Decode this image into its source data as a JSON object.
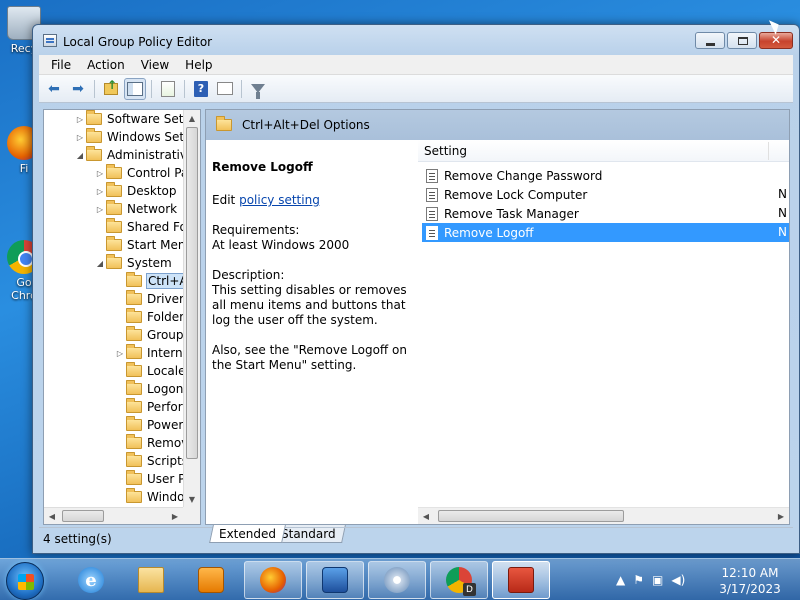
{
  "desktop": {
    "icons": [
      {
        "label": "Recy"
      },
      {
        "label": "Fi"
      },
      {
        "label": "Go"
      },
      {
        "label": "Chro"
      }
    ]
  },
  "window": {
    "title": "Local Group Policy Editor",
    "minimize": "",
    "maximize": "",
    "close": "✕"
  },
  "menu": [
    "File",
    "Action",
    "View",
    "Help"
  ],
  "toolbar": {
    "back": "⬅",
    "forward": "➡",
    "help_glyph": "?"
  },
  "tree": {
    "items": [
      {
        "label": "Software Setti",
        "indent": 1,
        "expander": "▷"
      },
      {
        "label": "Windows Setti",
        "indent": 1,
        "expander": "▷"
      },
      {
        "label": "Administrative",
        "indent": 1,
        "expander": "◢"
      },
      {
        "label": "Control Pa",
        "indent": 2,
        "expander": "▷"
      },
      {
        "label": "Desktop",
        "indent": 2,
        "expander": "▷"
      },
      {
        "label": "Network",
        "indent": 2,
        "expander": "▷"
      },
      {
        "label": "Shared Fol",
        "indent": 2,
        "expander": ""
      },
      {
        "label": "Start Menu",
        "indent": 2,
        "expander": ""
      },
      {
        "label": "System",
        "indent": 2,
        "expander": "◢"
      },
      {
        "label": "Ctrl+A",
        "indent": 3,
        "expander": "",
        "selected": true
      },
      {
        "label": "Driver I",
        "indent": 3,
        "expander": ""
      },
      {
        "label": "Folder",
        "indent": 3,
        "expander": ""
      },
      {
        "label": "Group",
        "indent": 3,
        "expander": ""
      },
      {
        "label": "Interne",
        "indent": 3,
        "expander": "▷"
      },
      {
        "label": "Locale",
        "indent": 3,
        "expander": ""
      },
      {
        "label": "Logon",
        "indent": 3,
        "expander": ""
      },
      {
        "label": "Perfor",
        "indent": 3,
        "expander": ""
      },
      {
        "label": "Power",
        "indent": 3,
        "expander": ""
      },
      {
        "label": "Remov",
        "indent": 3,
        "expander": ""
      },
      {
        "label": "Scripts",
        "indent": 3,
        "expander": ""
      },
      {
        "label": "User Pr",
        "indent": 3,
        "expander": ""
      },
      {
        "label": "Windo",
        "indent": 3,
        "expander": ""
      }
    ]
  },
  "right": {
    "header": "Ctrl+Alt+Del Options",
    "description": {
      "title": "Remove Logoff",
      "edit_prefix": "Edit",
      "edit_link": "policy setting",
      "requirements_label": "Requirements:",
      "requirements_value": "At least Windows 2000",
      "description_label": "Description:",
      "description_text": "This setting disables or removes all menu items and buttons that log the user off the system.",
      "also_text": "Also, see the \"Remove Logoff on the Start Menu\" setting."
    },
    "column_header": "Setting",
    "policies": [
      {
        "name": "Remove Change Password",
        "state": ""
      },
      {
        "name": "Remove Lock Computer",
        "state": "N"
      },
      {
        "name": "Remove Task Manager",
        "state": "N"
      },
      {
        "name": "Remove Logoff",
        "state": "N",
        "selected": true
      }
    ]
  },
  "tabs": [
    {
      "label": "Extended",
      "active": true
    },
    {
      "label": "Standard",
      "active": false
    }
  ],
  "status": "4 setting(s)",
  "clock": {
    "time": "12:10 AM",
    "date": "3/17/2023"
  }
}
